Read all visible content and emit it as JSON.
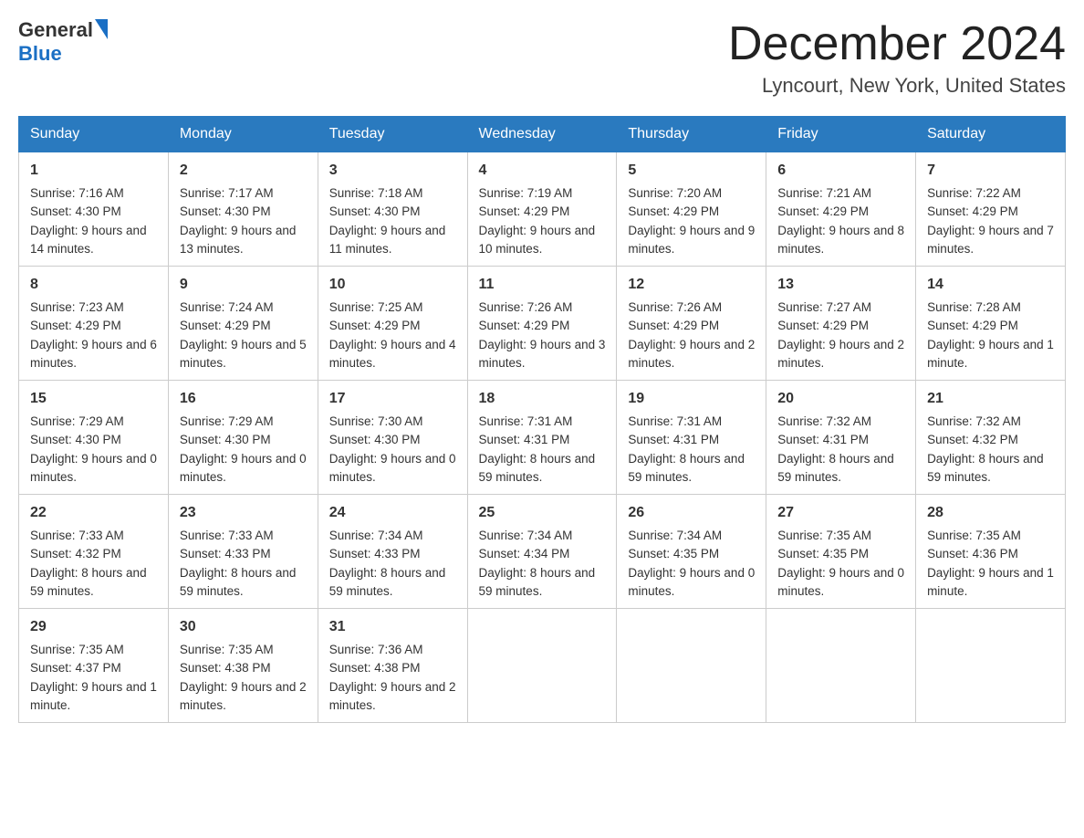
{
  "header": {
    "logo_general": "General",
    "logo_blue": "Blue",
    "month_title": "December 2024",
    "location": "Lyncourt, New York, United States"
  },
  "days_of_week": [
    "Sunday",
    "Monday",
    "Tuesday",
    "Wednesday",
    "Thursday",
    "Friday",
    "Saturday"
  ],
  "weeks": [
    [
      {
        "day": 1,
        "sunrise": "7:16 AM",
        "sunset": "4:30 PM",
        "daylight": "9 hours and 14 minutes."
      },
      {
        "day": 2,
        "sunrise": "7:17 AM",
        "sunset": "4:30 PM",
        "daylight": "9 hours and 13 minutes."
      },
      {
        "day": 3,
        "sunrise": "7:18 AM",
        "sunset": "4:30 PM",
        "daylight": "9 hours and 11 minutes."
      },
      {
        "day": 4,
        "sunrise": "7:19 AM",
        "sunset": "4:29 PM",
        "daylight": "9 hours and 10 minutes."
      },
      {
        "day": 5,
        "sunrise": "7:20 AM",
        "sunset": "4:29 PM",
        "daylight": "9 hours and 9 minutes."
      },
      {
        "day": 6,
        "sunrise": "7:21 AM",
        "sunset": "4:29 PM",
        "daylight": "9 hours and 8 minutes."
      },
      {
        "day": 7,
        "sunrise": "7:22 AM",
        "sunset": "4:29 PM",
        "daylight": "9 hours and 7 minutes."
      }
    ],
    [
      {
        "day": 8,
        "sunrise": "7:23 AM",
        "sunset": "4:29 PM",
        "daylight": "9 hours and 6 minutes."
      },
      {
        "day": 9,
        "sunrise": "7:24 AM",
        "sunset": "4:29 PM",
        "daylight": "9 hours and 5 minutes."
      },
      {
        "day": 10,
        "sunrise": "7:25 AM",
        "sunset": "4:29 PM",
        "daylight": "9 hours and 4 minutes."
      },
      {
        "day": 11,
        "sunrise": "7:26 AM",
        "sunset": "4:29 PM",
        "daylight": "9 hours and 3 minutes."
      },
      {
        "day": 12,
        "sunrise": "7:26 AM",
        "sunset": "4:29 PM",
        "daylight": "9 hours and 2 minutes."
      },
      {
        "day": 13,
        "sunrise": "7:27 AM",
        "sunset": "4:29 PM",
        "daylight": "9 hours and 2 minutes."
      },
      {
        "day": 14,
        "sunrise": "7:28 AM",
        "sunset": "4:29 PM",
        "daylight": "9 hours and 1 minute."
      }
    ],
    [
      {
        "day": 15,
        "sunrise": "7:29 AM",
        "sunset": "4:30 PM",
        "daylight": "9 hours and 0 minutes."
      },
      {
        "day": 16,
        "sunrise": "7:29 AM",
        "sunset": "4:30 PM",
        "daylight": "9 hours and 0 minutes."
      },
      {
        "day": 17,
        "sunrise": "7:30 AM",
        "sunset": "4:30 PM",
        "daylight": "9 hours and 0 minutes."
      },
      {
        "day": 18,
        "sunrise": "7:31 AM",
        "sunset": "4:31 PM",
        "daylight": "8 hours and 59 minutes."
      },
      {
        "day": 19,
        "sunrise": "7:31 AM",
        "sunset": "4:31 PM",
        "daylight": "8 hours and 59 minutes."
      },
      {
        "day": 20,
        "sunrise": "7:32 AM",
        "sunset": "4:31 PM",
        "daylight": "8 hours and 59 minutes."
      },
      {
        "day": 21,
        "sunrise": "7:32 AM",
        "sunset": "4:32 PM",
        "daylight": "8 hours and 59 minutes."
      }
    ],
    [
      {
        "day": 22,
        "sunrise": "7:33 AM",
        "sunset": "4:32 PM",
        "daylight": "8 hours and 59 minutes."
      },
      {
        "day": 23,
        "sunrise": "7:33 AM",
        "sunset": "4:33 PM",
        "daylight": "8 hours and 59 minutes."
      },
      {
        "day": 24,
        "sunrise": "7:34 AM",
        "sunset": "4:33 PM",
        "daylight": "8 hours and 59 minutes."
      },
      {
        "day": 25,
        "sunrise": "7:34 AM",
        "sunset": "4:34 PM",
        "daylight": "8 hours and 59 minutes."
      },
      {
        "day": 26,
        "sunrise": "7:34 AM",
        "sunset": "4:35 PM",
        "daylight": "9 hours and 0 minutes."
      },
      {
        "day": 27,
        "sunrise": "7:35 AM",
        "sunset": "4:35 PM",
        "daylight": "9 hours and 0 minutes."
      },
      {
        "day": 28,
        "sunrise": "7:35 AM",
        "sunset": "4:36 PM",
        "daylight": "9 hours and 1 minute."
      }
    ],
    [
      {
        "day": 29,
        "sunrise": "7:35 AM",
        "sunset": "4:37 PM",
        "daylight": "9 hours and 1 minute."
      },
      {
        "day": 30,
        "sunrise": "7:35 AM",
        "sunset": "4:38 PM",
        "daylight": "9 hours and 2 minutes."
      },
      {
        "day": 31,
        "sunrise": "7:36 AM",
        "sunset": "4:38 PM",
        "daylight": "9 hours and 2 minutes."
      },
      null,
      null,
      null,
      null
    ]
  ]
}
